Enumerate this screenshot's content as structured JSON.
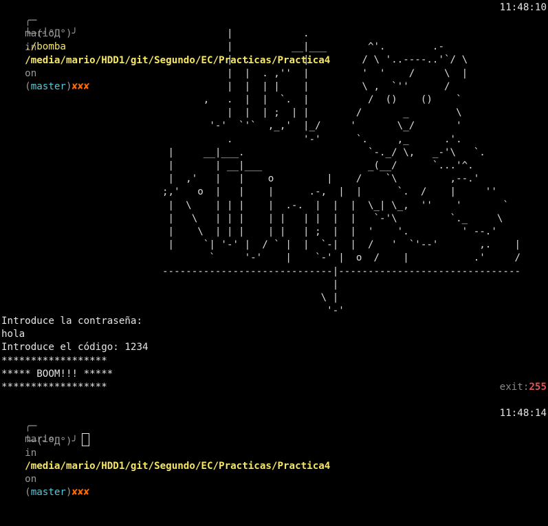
{
  "prompt1": {
    "corner_top": "╭─",
    "user": "mario",
    "in_word": "in",
    "path": "/media/mario/HDD1/git/Segundo/EC/Practicas/Practica4",
    "on_word": "on",
    "paren_open": "(",
    "branch": "master",
    "paren_close": ")",
    "dirty": "✘✘✘",
    "time": "11:48:10",
    "corner_bottom": "╰─",
    "face": "(╯°Д°)╯",
    "command": "./bomba"
  },
  "ascii_art": "           |            .\n           |          __|___       ^'.        .-\n           |  .         |         / \\ '..----..'`/ \\\n           |  |  . ,''  |         '  '    /     \\  |\n           |  |  | |    |         \\ ,  `''      /\n       ,   .  |  |  `.  |          /  ()    ()    `\n           |  |  | ;  | |        /       _        \\\n        '-'  `'`  ,_,'  |_/     '       \\_/       '\n           .            '-'      `.     ,_      .'.\n |     __|___.                     `-._/ \\,   _-'\\   `.\n |       | __|___                  _(__/      `...'^.\n |  ,'   |   |    o         |    /    `\\         ,--.'\n;,'   o  |   |    |      .-,  |  |      `.  /    |     ''\n |  \\    | | |    |  .-.  |  |  |  \\_| \\_,  ''    '       `\n |   \\   | | |    | |   | |  |  |   `-'\\         `._     \\\n |    \\  | | |    | |   | ;  |  |  '    '.         ' --.'\n |     `| '-' |  / ` |  |  `-|  |  /   '  `'--'       ,.    |\n        `     '-'    |    `-' |  o  /    |           .'     /\n-----------------------------|-------------------------------\n                             |\n                           \\ |\n                            '-'",
  "output": {
    "line1": "Introduce la contraseña:",
    "line2": "hola",
    "line3": "Introduce el código: 1234",
    "line4": "******************",
    "line5": "***** BOOM!!! *****",
    "line6": "******************"
  },
  "exit_status": {
    "label": "exit:",
    "code": "255"
  },
  "prompt2": {
    "corner_top": "╭─",
    "user": "mario",
    "in_word": "in",
    "path": "/media/mario/HDD1/git/Segundo/EC/Practicas/Practica4",
    "on_word": "on",
    "paren_open": "(",
    "branch": "master",
    "paren_close": ")",
    "dirty": "✘✘✘",
    "time": "11:48:14",
    "corner_bottom": "╰─",
    "face": "(╯°Д°)╯"
  },
  "colors": {
    "background": "#000000",
    "path": "#f5e663",
    "branch": "#56c8d8",
    "dirty": "#ff6a00",
    "exit_code": "#e05252"
  }
}
